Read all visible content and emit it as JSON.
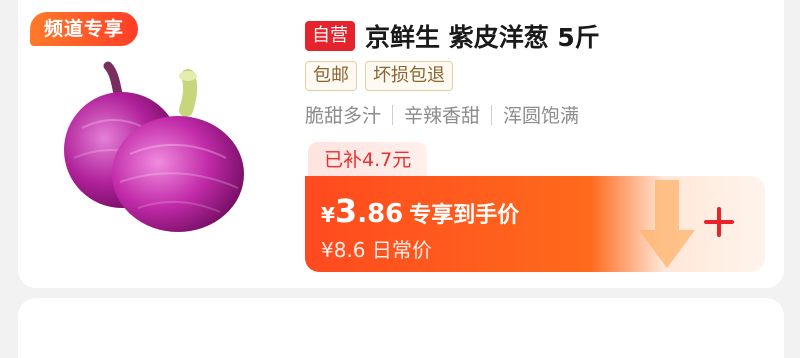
{
  "badge": {
    "channel": "频道专享"
  },
  "product": {
    "self_tag": "自营",
    "title": "京鲜生 紫皮洋葱 5斤",
    "tags": [
      "包邮",
      "坏损包退"
    ],
    "features": [
      "脆甜多汁",
      "辛辣香甜",
      "浑圆饱满"
    ],
    "image": "red-onion-photo"
  },
  "promo": {
    "subsidy": "已补4.7元",
    "currency": "¥",
    "price_int": "3",
    "price_dec": ".86",
    "price_label": "专享到手价",
    "daily_price": "¥8.6 日常价"
  },
  "icons": {
    "add": "plus-icon",
    "deco": "down-arrow-icon"
  },
  "colors": {
    "accent": "#ff4a1f",
    "red": "#e4232d",
    "tag_text": "#8a6432",
    "subsidy_text": "#ea2f2f"
  }
}
